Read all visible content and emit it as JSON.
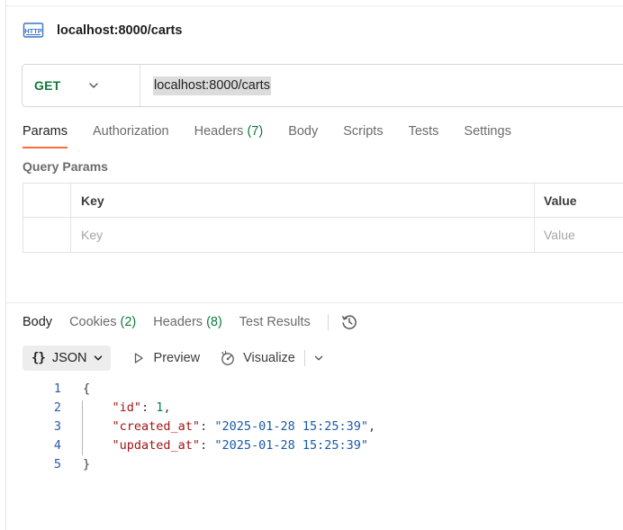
{
  "request": {
    "title": "localhost:8000/carts",
    "icon": "http-icon",
    "method": "GET",
    "method_color": "#0f7a3a",
    "url": "localhost:8000/carts"
  },
  "request_tabs": [
    {
      "label": "Params",
      "count": "",
      "active": true
    },
    {
      "label": "Authorization",
      "count": ""
    },
    {
      "label": "Headers",
      "count": "(7)"
    },
    {
      "label": "Body",
      "count": ""
    },
    {
      "label": "Scripts",
      "count": ""
    },
    {
      "label": "Tests",
      "count": ""
    },
    {
      "label": "Settings",
      "count": ""
    }
  ],
  "query_params": {
    "label": "Query Params",
    "header": {
      "key": "Key",
      "value": "Value"
    },
    "placeholder": {
      "key": "Key",
      "value": "Value"
    }
  },
  "response_tabs": [
    {
      "label": "Body",
      "count": "",
      "active": true
    },
    {
      "label": "Cookies",
      "count": "(2)"
    },
    {
      "label": "Headers",
      "count": "(8)"
    },
    {
      "label": "Test Results",
      "count": ""
    }
  ],
  "response_toolbar": {
    "format_braces": "{}",
    "format": "JSON",
    "preview": "Preview",
    "visualize": "Visualize"
  },
  "response_body": {
    "line_numbers": [
      "1",
      "2",
      "3",
      "4",
      "5"
    ],
    "open_brace": "{",
    "close_brace": "}",
    "fields": [
      {
        "key": "\"id\"",
        "value": "1",
        "type": "number",
        "comma": ","
      },
      {
        "key": "\"created_at\"",
        "value": "\"2025-01-28 15:25:39\"",
        "type": "string",
        "comma": ","
      },
      {
        "key": "\"updated_at\"",
        "value": "\"2025-01-28 15:25:39\"",
        "type": "string",
        "comma": ""
      }
    ]
  },
  "colors": {
    "accent": "#ff6c37",
    "count_green": "#0f7a3a",
    "json_key": "#a31515",
    "json_string": "#1a5aa6",
    "json_number": "#0a7a5a"
  }
}
